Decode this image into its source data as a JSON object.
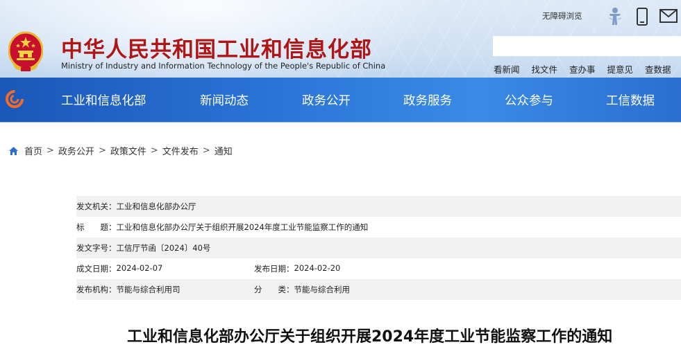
{
  "header": {
    "site_title": "中华人民共和国工业和信息化部",
    "site_subtitle": "Ministry of Industry and Information Technology of the People's Republic of China",
    "accessibility_link": "无障碍浏览",
    "search": {
      "placeholder": "",
      "value": ""
    },
    "quick_links": [
      "看新闻",
      "找文件",
      "查办事",
      "提意见",
      "查数据"
    ]
  },
  "nav": {
    "items": [
      "工业和信息化部",
      "新闻动态",
      "政务公开",
      "政务服务",
      "公众参与",
      "工信数据"
    ]
  },
  "breadcrumb": [
    "首页",
    "政务公开",
    "政策文件",
    "文件发布",
    "通知"
  ],
  "meta": {
    "issuer_label": "发文机关：",
    "issuer": "工业和信息化部办公厅",
    "title_label": "标　　题：",
    "title": "工业和信息化部办公厅关于组织开展2024年度工业节能监察工作的通知",
    "doc_no_label": "发文字号：",
    "doc_no": "工信厅节函〔2024〕40号",
    "created_label": "成文日期：",
    "created": "2024-02-07",
    "published_label": "发布日期：",
    "published": "2024-02-20",
    "agency_label": "发布机构：",
    "agency": "节能与综合利用司",
    "category_label": "分　　类：",
    "category": "节能与综合利用"
  },
  "article": {
    "title": "工业和信息化部办公厅关于组织开展2024年度工业节能监察工作的通知"
  },
  "colors": {
    "title_red": "#b01515",
    "nav_blue": "#2a6fcf",
    "row_shade": "#f1f1f1"
  },
  "icons": [
    "national-emblem-icon",
    "accessibility-person-icon",
    "mobile-phone-icon",
    "mail-icon",
    "miit-logo-icon",
    "home-icon"
  ]
}
